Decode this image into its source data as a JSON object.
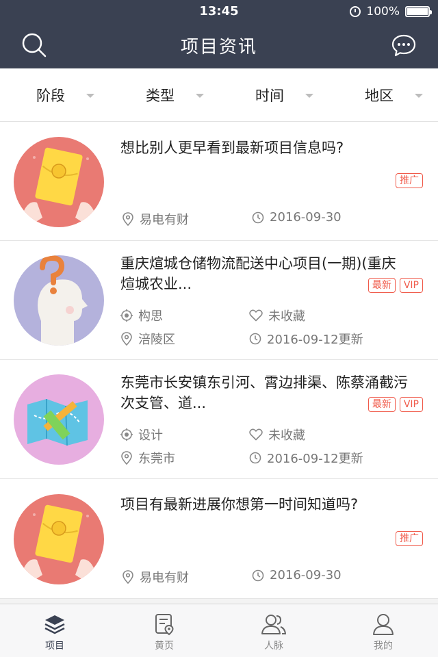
{
  "status_bar": {
    "time": "13:45",
    "battery": "100%"
  },
  "header": {
    "title": "项目资讯",
    "search_icon": "search-icon",
    "chat_icon": "chat-bubble-icon"
  },
  "filters": [
    {
      "label": "阶段"
    },
    {
      "label": "类型"
    },
    {
      "label": "时间"
    },
    {
      "label": "地区"
    }
  ],
  "items": [
    {
      "title": "想比别人更早看到最新项目信息吗?",
      "tags": [
        "推广"
      ],
      "meta": {
        "location": "易电有财",
        "date": "2016-09-30"
      },
      "avatar_color": "#e97a73",
      "avatar_icon": "red-envelope-icon"
    },
    {
      "title": "重庆煊城仓储物流配送中心项目(一期)(重庆煊城农业...",
      "tags": [
        "最新",
        "VIP"
      ],
      "meta": {
        "stage": "构思",
        "favorite": "未收藏",
        "location": "涪陵区",
        "date": "2016-09-12更新"
      },
      "avatar_color": "#b4b2dc",
      "avatar_icon": "thinking-head-icon"
    },
    {
      "title": "东莞市长安镇东引河、霄边排渠、陈蔡涌截污次支管、道...",
      "tags": [
        "最新",
        "VIP"
      ],
      "meta": {
        "stage": "设计",
        "favorite": "未收藏",
        "location": "东莞市",
        "date": "2016-09-12更新"
      },
      "avatar_color": "#e7aee0",
      "avatar_icon": "map-pencil-icon"
    },
    {
      "title": "项目有最新进展你想第一时间知道吗?",
      "tags": [
        "推广"
      ],
      "meta": {
        "location": "易电有财",
        "date": "2016-09-30"
      },
      "avatar_color": "#e97a73",
      "avatar_icon": "red-envelope-icon"
    }
  ],
  "tabbar": [
    {
      "label": "项目",
      "icon": "layers-icon",
      "active": true
    },
    {
      "label": "黄页",
      "icon": "yellow-pages-icon",
      "active": false
    },
    {
      "label": "人脉",
      "icon": "contacts-icon",
      "active": false
    },
    {
      "label": "我的",
      "icon": "profile-icon",
      "active": false
    }
  ],
  "colors": {
    "header_bg": "#3a4152",
    "tag_red": "#f05a4a",
    "meta_gray": "#777777"
  }
}
